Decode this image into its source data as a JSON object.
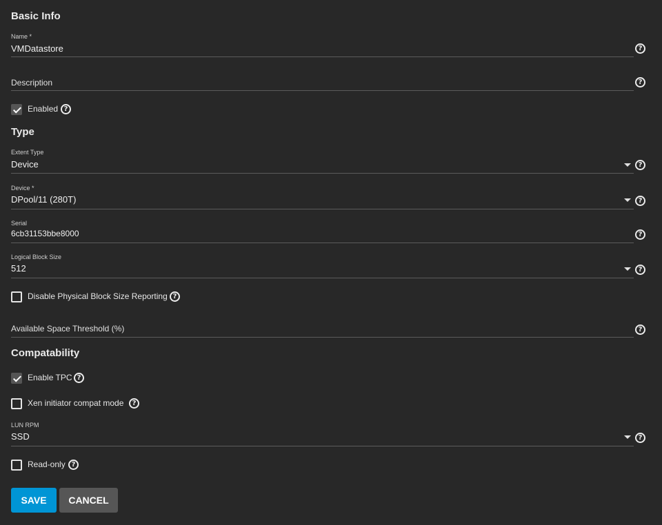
{
  "sections": {
    "basic_info": "Basic Info",
    "type": "Type",
    "compatability": "Compatability"
  },
  "fields": {
    "name": {
      "label": "Name *",
      "value": "VMDatastore"
    },
    "description": {
      "placeholder": "Description"
    },
    "extent_type": {
      "label": "Extent Type",
      "value": "Device"
    },
    "device": {
      "label": "Device *",
      "value": "DPool/11 (280T)"
    },
    "serial": {
      "label": "Serial",
      "value": "6cb31153bbe8000"
    },
    "logical_block_size": {
      "label": "Logical Block Size",
      "value": "512"
    },
    "available_space_threshold": {
      "placeholder": "Available Space Threshold (%)"
    },
    "lun_rpm": {
      "label": "LUN RPM",
      "value": "SSD"
    }
  },
  "checkboxes": {
    "enabled": {
      "label": "Enabled",
      "checked": true
    },
    "disable_pbs": {
      "label": "Disable Physical Block Size Reporting",
      "checked": false
    },
    "enable_tpc": {
      "label": "Enable TPC",
      "checked": true
    },
    "xen_compat": {
      "label": "Xen initiator compat mode",
      "checked": false
    },
    "read_only": {
      "label": "Read-only",
      "checked": false
    }
  },
  "help_glyph": "?",
  "buttons": {
    "save": "SAVE",
    "cancel": "CANCEL"
  }
}
